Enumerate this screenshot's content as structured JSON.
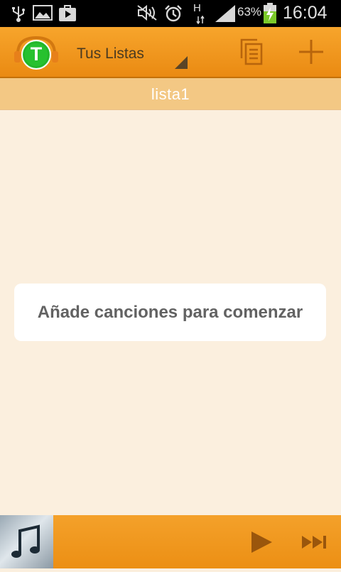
{
  "status_bar": {
    "battery_percent": "63%",
    "time": "16:04",
    "network_type": "H",
    "icons": [
      "usb-icon",
      "image-icon",
      "play-store-icon",
      "mute-icon",
      "alarm-icon",
      "signal-icon",
      "battery-charging-icon"
    ]
  },
  "action_bar": {
    "logo_letter": "T",
    "spinner_label": "Tus Listas",
    "icons": [
      "copy-icon",
      "add-icon"
    ]
  },
  "playlist": {
    "title": "lista1"
  },
  "empty_state": {
    "message": "Añade canciones para comenzar"
  },
  "player": {
    "icons": [
      "music-note-icon",
      "play-icon",
      "next-icon"
    ]
  },
  "colors": {
    "accent": "#f09a1e",
    "background": "#fbefde",
    "subheader": "#f3c884",
    "text_dark": "#626262"
  }
}
